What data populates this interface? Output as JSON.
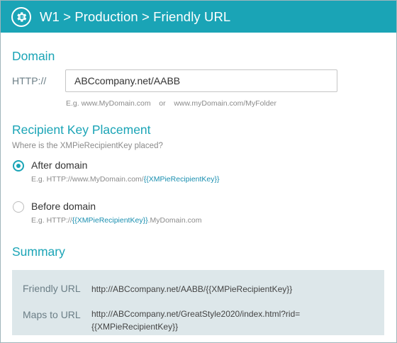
{
  "title": "W1 > Production > Friendly URL",
  "icons": {
    "title": "gear-icon"
  },
  "colors": {
    "accent": "#1aa4b6",
    "key_link": "#1a8fb0",
    "summary_bg": "#dde7ea"
  },
  "domain": {
    "heading": "Domain",
    "protocol_label": "HTTP://",
    "value": "ABCcompany.net/AABB",
    "hint_prefix": "E.g. www.MyDomain.com",
    "hint_or": "or",
    "hint_suffix": "www.myDomain.com/MyFolder"
  },
  "recipient": {
    "heading": "Recipient Key Placement",
    "question": "Where is the XMPieRecipientKey placed?",
    "options": [
      {
        "label": "After domain",
        "selected": true,
        "example_pre": "E.g. HTTP://www.MyDomain.com/",
        "example_key": "{{XMPieRecipientKey}}",
        "example_post": ""
      },
      {
        "label": "Before domain",
        "selected": false,
        "example_pre": "E.g. HTTP://",
        "example_key": "{{XMPieRecipientKey}}",
        "example_post": ".MyDomain.com"
      }
    ]
  },
  "summary": {
    "heading": "Summary",
    "friendly_url_label": "Friendly URL",
    "friendly_url_value": "http://ABCcompany.net/AABB/{{XMPieRecipientKey}}",
    "maps_to_label": "Maps to URL",
    "maps_to_value_line1": "http://ABCcompany.net/GreatStyle2020/index.html?rid=",
    "maps_to_value_line2": "{{XMPieRecipientKey}}"
  }
}
